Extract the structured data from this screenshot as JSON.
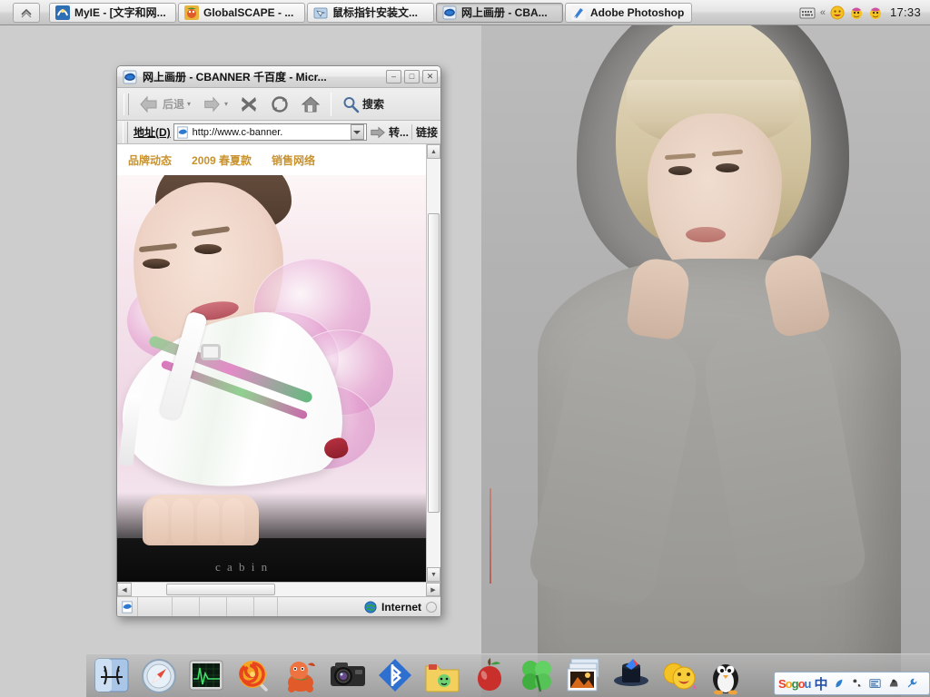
{
  "desktop": {
    "background_color": "#cdcdcd",
    "wallpaper_description": "blonde model in grey hooded sweatshirt"
  },
  "taskbar": {
    "start_button": {
      "name": "show-desktop-chevron",
      "icon": "chevron-up-icon"
    },
    "tasks": [
      {
        "label": "MyIE - [文字和网...",
        "icon": "myie-icon",
        "active": false
      },
      {
        "label": "GlobalSCAPE - ...",
        "icon": "globalscape-icon",
        "active": false
      },
      {
        "label": "鼠标指针安装文...",
        "icon": "folder-icon",
        "active": false
      },
      {
        "label": "网上画册 - CBA...",
        "icon": "ie-icon",
        "active": true
      },
      {
        "label": "Adobe Photoshop",
        "icon": "photoshop-icon",
        "active": false
      }
    ],
    "tray": {
      "icons": [
        "keyboard-icon",
        "smiley-icon",
        "qq-penguin-icon",
        "qq-penguin-icon"
      ],
      "overflow_chevron": "«",
      "clock": "17:33"
    }
  },
  "browser": {
    "title": "网上画册 - CBANNER 千百度 - Micr...",
    "app_icon": "ie-icon",
    "window_controls": {
      "minimize": "–",
      "maximize": "□",
      "close": "✕"
    },
    "toolbar": {
      "back_label": "后退",
      "forward_label": "",
      "stop_label": "",
      "refresh_label": "",
      "home_label": "",
      "search_label": "搜索",
      "back_icon": "arrow-left-icon",
      "forward_icon": "arrow-right-icon",
      "stop_icon": "stop-x-icon",
      "refresh_icon": "refresh-icon",
      "home_icon": "home-icon",
      "search_icon": "magnifier-icon"
    },
    "address_bar": {
      "label": "地址(D)",
      "favicon": "ie-page-icon",
      "url": "http://www.c-banner.",
      "dropdown_icon": "chevron-down-icon",
      "go_label": "转...",
      "go_icon": "go-arrow-icon",
      "links_label": "链接"
    },
    "status_bar": {
      "page_icon": "page-icon",
      "zone_label": "Internet",
      "zone_icon": "globe-icon",
      "resize_grip": "resize-grip"
    },
    "scrollbars": {
      "vertical_up": "▲",
      "vertical_down": "▼",
      "horizontal_left": "◀",
      "horizontal_right": "▶"
    }
  },
  "webpage": {
    "nav_items": [
      "品牌动态",
      "2009 春夏款",
      "销售网络"
    ],
    "nav_color": "#c8922e",
    "hero_description": "CBANNER fashion advert: model resting her face next to a white high-heeled shoe with green and pink stripes",
    "hero_logo_text": "c a b i n"
  },
  "dock": {
    "items": [
      {
        "name": "finder-icon",
        "label": "Finder"
      },
      {
        "name": "safari-icon",
        "label": "Safari"
      },
      {
        "name": "activity-monitor-icon",
        "label": "Activity Monitor"
      },
      {
        "name": "lollipop-icon",
        "label": "Lollipop"
      },
      {
        "name": "dragon-icon",
        "label": "Dragon"
      },
      {
        "name": "camera-icon",
        "label": "Camera"
      },
      {
        "name": "bluetooth-icon",
        "label": "Bluetooth"
      },
      {
        "name": "folder-icon",
        "label": "Folder"
      },
      {
        "name": "apple-icon",
        "label": "Apple"
      },
      {
        "name": "clover-icon",
        "label": "Clover"
      },
      {
        "name": "photos-icon",
        "label": "Photos"
      },
      {
        "name": "magic-hat-icon",
        "label": "Magic Hat"
      },
      {
        "name": "smiley-icon",
        "label": "Smileys"
      },
      {
        "name": "penguin-icon",
        "label": "Penguin"
      }
    ]
  },
  "ime": {
    "logo": {
      "s": "S",
      "o1": "o",
      "g": "g",
      "o2": "o",
      "u": "u"
    },
    "mode_label": "中",
    "icons": [
      "moon-icon",
      "punctuation-icon",
      "keyboard-icon",
      "toolbox-icon",
      "wrench-icon"
    ]
  }
}
